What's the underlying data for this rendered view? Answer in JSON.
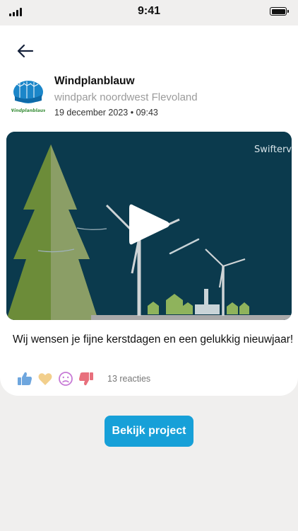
{
  "status_bar": {
    "time": "9:41"
  },
  "publisher": {
    "name": "Windplanblauw",
    "subtitle": "windpark noordwest Flevoland",
    "date": "19 december 2023 • 09:43",
    "logo_text": "Windplanblauw"
  },
  "media": {
    "watermark": "Swifterv"
  },
  "post": {
    "message": "Wij wensen je fijne kerstdagen en een gelukkig nieuwjaar!"
  },
  "reactions": {
    "icons": [
      "thumbs-up-icon",
      "heart-icon",
      "sad-face-icon",
      "thumbs-down-icon"
    ],
    "count_label": "13 reacties"
  },
  "cta": {
    "label": "Bekijk project"
  },
  "colors": {
    "accent": "#17a0d8",
    "video_bg": "#0b3a4d",
    "tree": "#6c8c39",
    "thumbs_up": "#6ea6de",
    "heart": "#f2cf8c",
    "sad": "#c77ad6",
    "thumbs_down": "#e8707d"
  }
}
